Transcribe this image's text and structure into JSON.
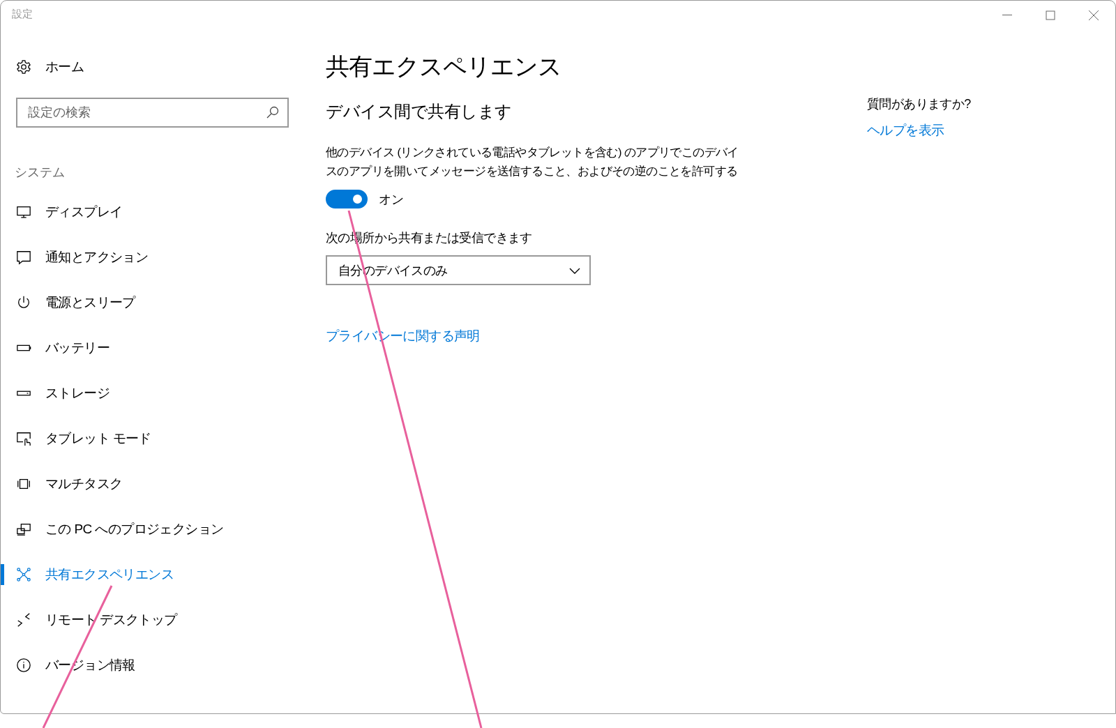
{
  "window": {
    "title": "設定"
  },
  "sidebar": {
    "home": "ホーム",
    "search": {
      "placeholder": "設定の検索"
    },
    "section": "システム",
    "items": [
      {
        "label": "ディスプレイ",
        "selected": false
      },
      {
        "label": "通知とアクション",
        "selected": false
      },
      {
        "label": "電源とスリープ",
        "selected": false
      },
      {
        "label": "バッテリー",
        "selected": false
      },
      {
        "label": "ストレージ",
        "selected": false
      },
      {
        "label": "タブレット モード",
        "selected": false
      },
      {
        "label": "マルチタスク",
        "selected": false
      },
      {
        "label": "この PC へのプロジェクション",
        "selected": false
      },
      {
        "label": "共有エクスペリエンス",
        "selected": true
      },
      {
        "label": "リモート デスクトップ",
        "selected": false
      },
      {
        "label": "バージョン情報",
        "selected": false
      }
    ]
  },
  "main": {
    "title": "共有エクスペリエンス",
    "section_title": "デバイス間で共有します",
    "description": "他のデバイス (リンクされている電話やタブレットを含む) のアプリでこのデバイスのアプリを開いてメッセージを送信すること、およびその逆のことを許可する",
    "toggle": {
      "on": true,
      "label": "オン"
    },
    "dropdown_label": "次の場所から共有または受信できます",
    "dropdown": {
      "value": "自分のデバイスのみ"
    },
    "privacy_link": "プライバシーに関する声明"
  },
  "help": {
    "question": "質問がありますか?",
    "link": "ヘルプを表示"
  }
}
